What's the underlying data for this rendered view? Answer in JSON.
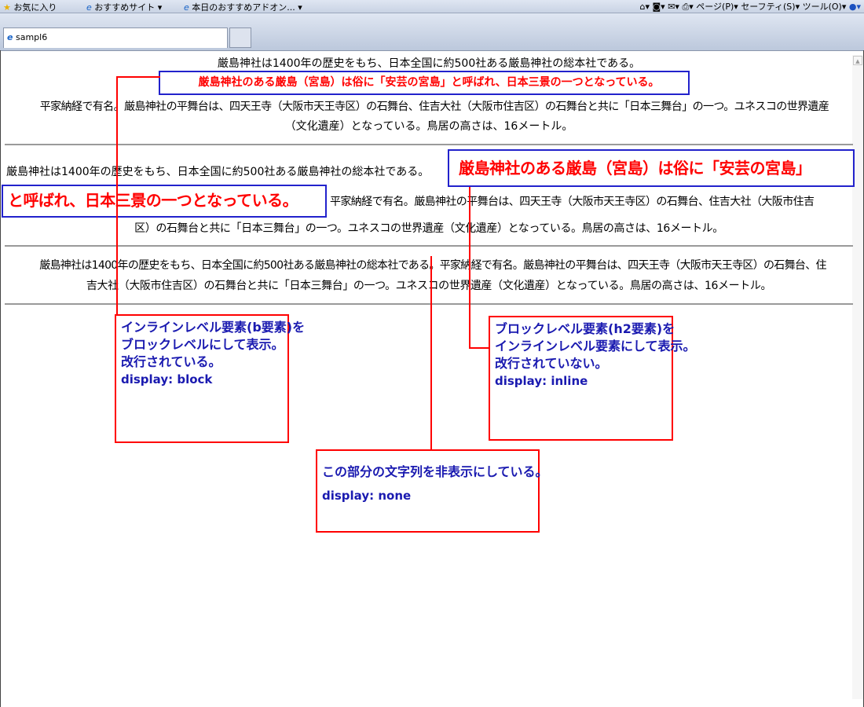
{
  "browser": {
    "favorites_label": "お気に入り",
    "suggested_sites_label": "おすすめサイト",
    "addons_label": "本日のおすすめアドオン...",
    "command_bar": [
      "ページ(P)",
      "セーフティ(S)",
      "ツール(O)"
    ],
    "tab_title": "sampl6"
  },
  "section1": {
    "p1": "厳島神社は1400年の歴史をもち、日本全国に約500社ある厳島神社の総本社である。",
    "h2": "厳島神社のある厳島（宮島）は俗に「安芸の宮島」と呼ばれ、日本三景の一つとなっている。",
    "p2a": "平家納経で有名。厳島神社の平舞台は、四天王寺（大阪市天王寺区）の石舞台、住吉大社（大阪市住吉区）の石舞台と共に「日本三舞台」の一つ。ユネスコの世界遺産",
    "p2b": "（文化遺産）となっている。鳥居の高さは、16メートル。"
  },
  "section2": {
    "p1": "厳島神社は1400年の歴史をもち、日本全国に約500社ある厳島神社の総本社である。",
    "h2a": "厳島神社のある厳島（宮島）は俗に「安芸の宮島」",
    "h2b": "と呼ばれ、日本三景の一つとなっている。",
    "p2a": "平家納経で有名。厳島神社の平舞台は、四天王寺（大阪市天王寺区）の石舞台、住吉大社（大阪市住吉",
    "p2b": "区）の石舞台と共に「日本三舞台」の一つ。ユネスコの世界遺産（文化遺産）となっている。鳥居の高さは、16メートル。"
  },
  "section3": {
    "line1": "厳島神社は1400年の歴史をもち、日本全国に約500社ある厳島神社の総本社である。平家納経で有名。厳島神社の平舞台は、四天王寺（大阪市天王寺区）の石舞台、住",
    "line2": "吉大社（大阪市住吉区）の石舞台と共に「日本三舞台」の一つ。ユネスコの世界遺産（文化遺産）となっている。鳥居の高さは、16メートル。"
  },
  "annotations": {
    "block": {
      "lines": [
        "インラインレベル要素(b要素)を",
        "ブロックレベルにして表示。",
        "改行されている。"
      ],
      "code": "display: block"
    },
    "inline": {
      "lines": [
        "ブロックレベル要素(h2要素)を",
        "インラインレベル要素にして表示。",
        "改行されていない。"
      ],
      "code": "display: inline"
    },
    "none": {
      "lines": [
        "この部分の文字列を非表示にしている。"
      ],
      "code": "display: none"
    }
  },
  "colors": {
    "heading_red": "#ff0000",
    "annotation_blue": "#1a1ab0",
    "box_blue": "#2222cc"
  }
}
